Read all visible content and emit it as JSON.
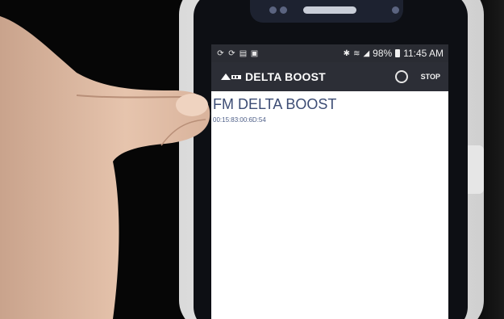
{
  "status_bar": {
    "left_icons": [
      "sync-icon",
      "sync-icon",
      "doc-icon",
      "image-icon"
    ],
    "battery_percent": "98%",
    "time": "11:45 AM"
  },
  "app_bar": {
    "title": "DELTA BOOST",
    "stop_label": "STOP"
  },
  "device": {
    "name": "FM DELTA BOOST",
    "mac": "00:15:83:00:6D:54"
  },
  "colors": {
    "app_bar_bg": "#2c2e36",
    "device_text": "#3c4c74"
  }
}
